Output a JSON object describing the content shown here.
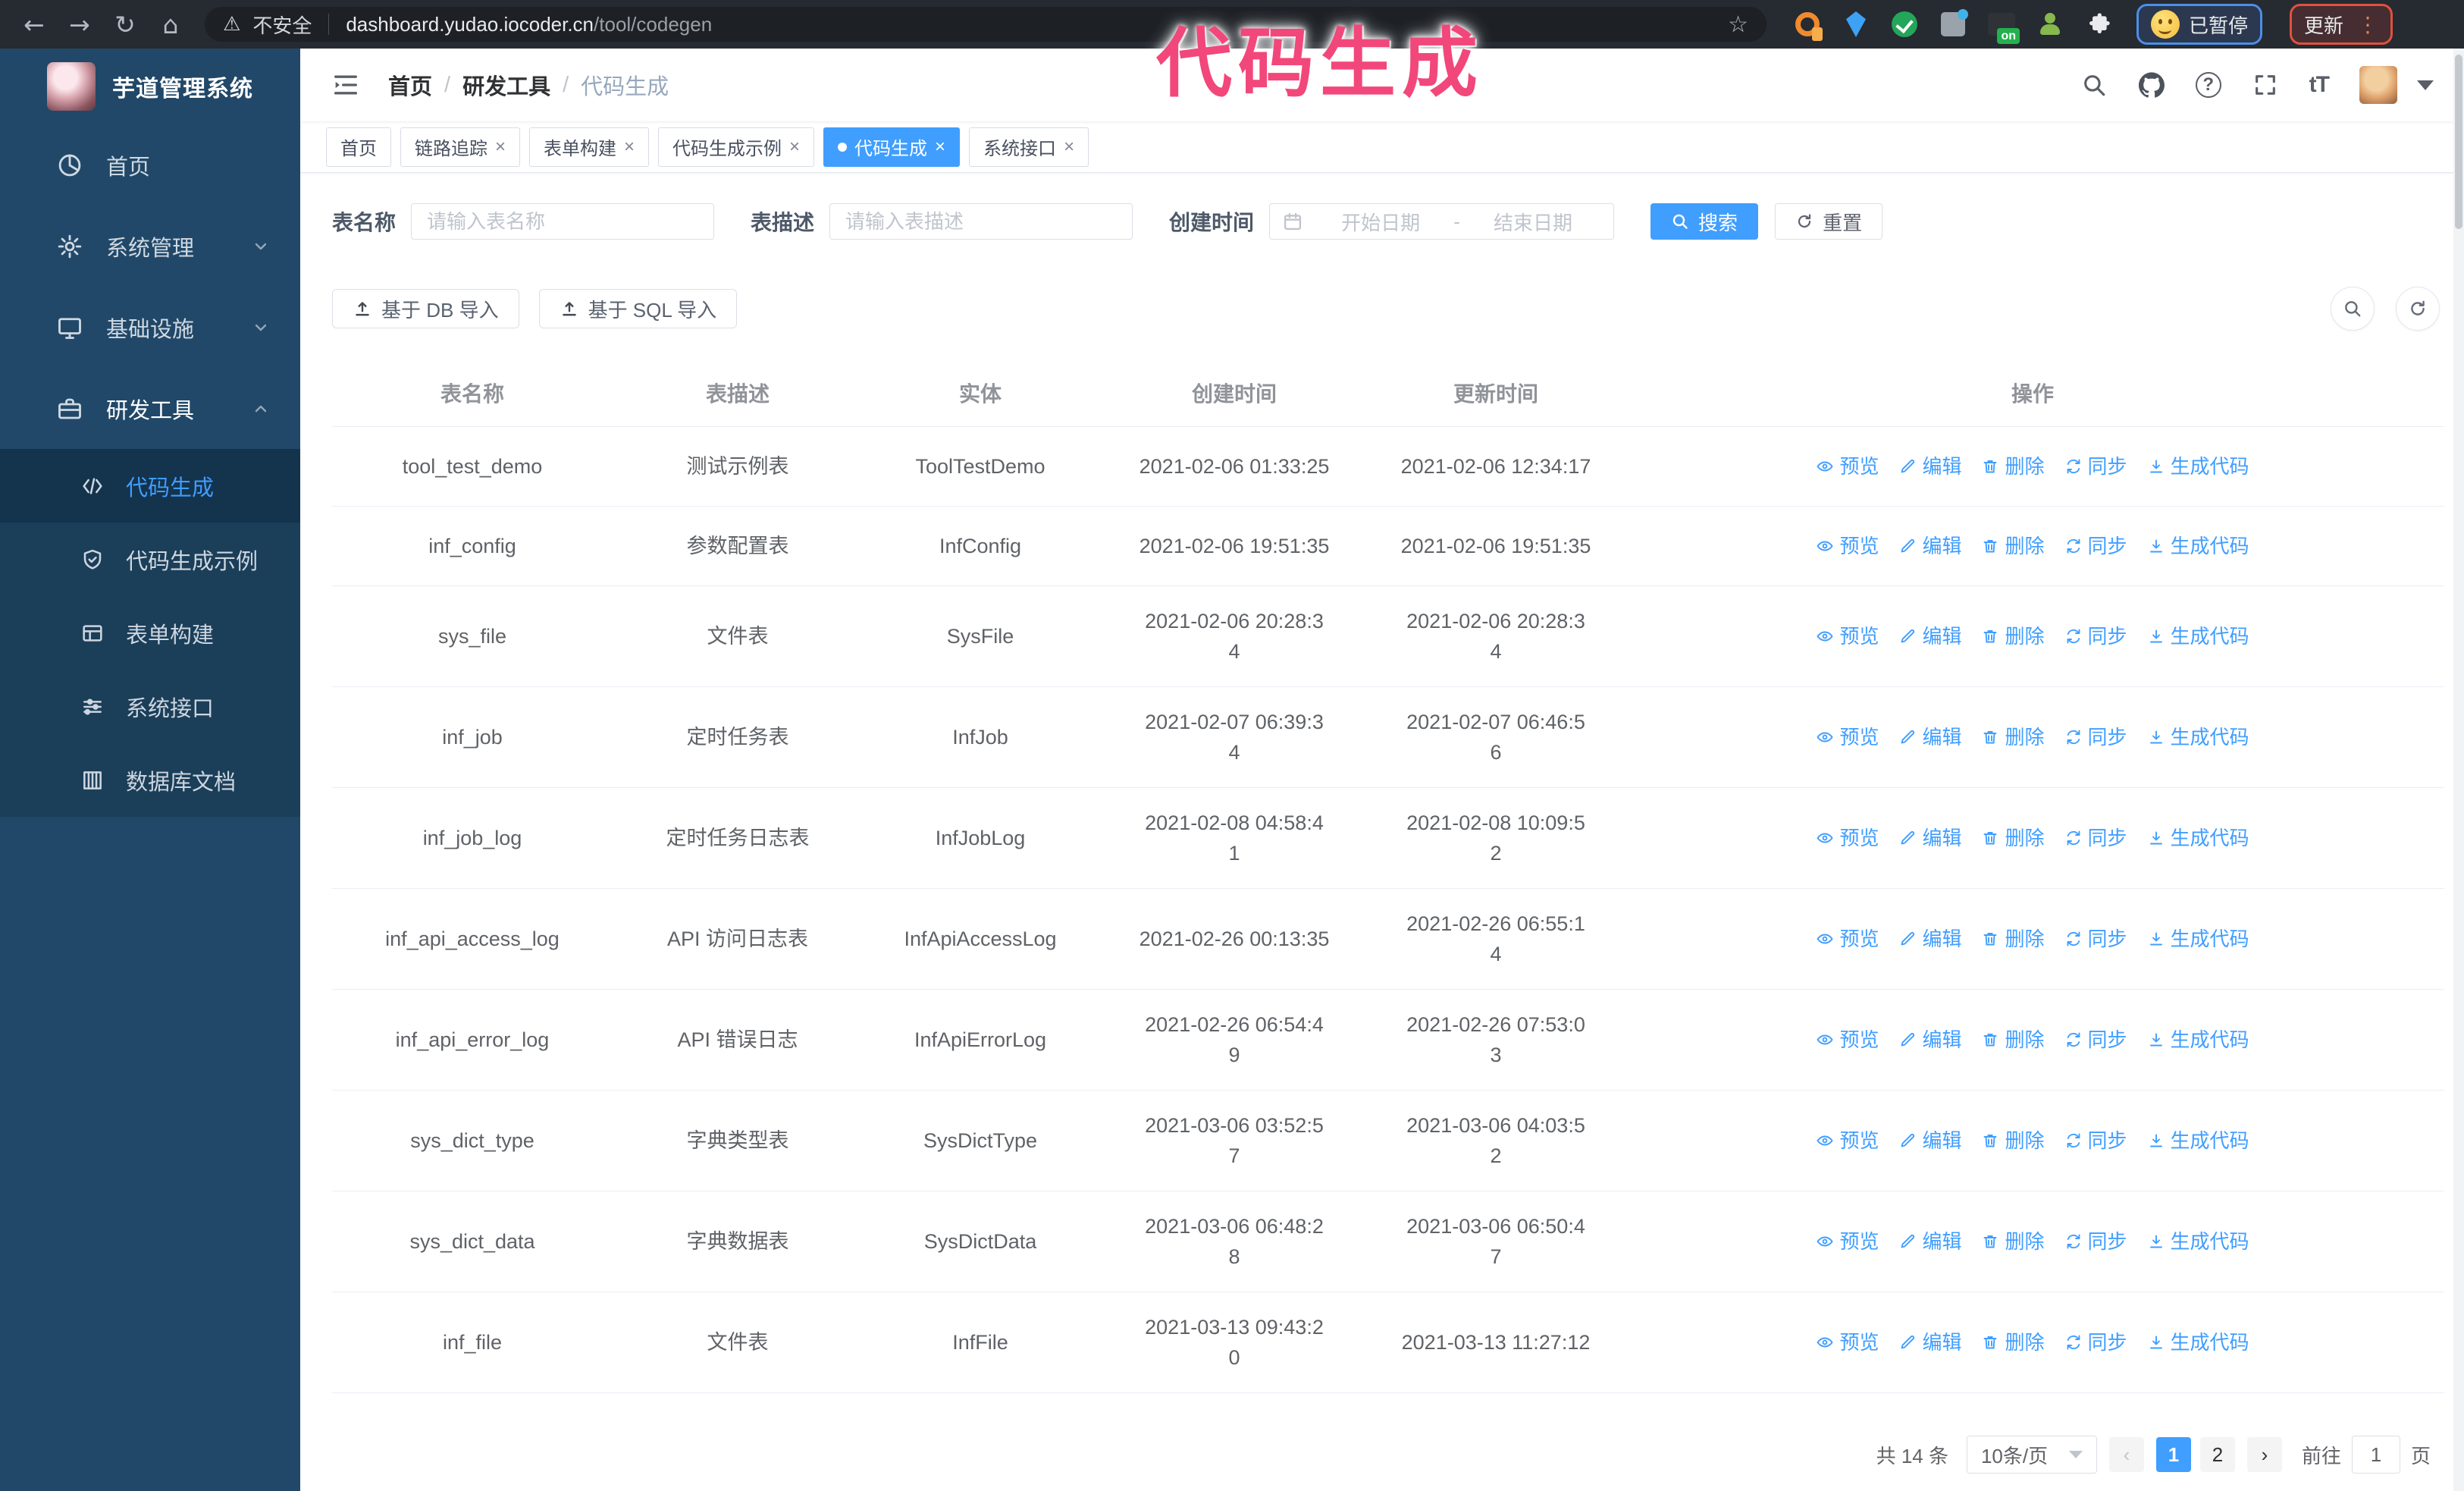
{
  "browser": {
    "security_label": "不安全",
    "url_host": "dashboard.yudao.iocoder.cn",
    "url_path": "/tool/codegen",
    "extension_badge": "on",
    "paused_badge": "已暂停",
    "update_button": "更新",
    "extension_icons": [
      "key-extension-icon",
      "gem-extension-icon",
      "check-extension-icon",
      "grid-extension-icon",
      "onbox-extension-icon",
      "person-extension-icon",
      "puzzle-extension-icon"
    ]
  },
  "glyphs": {
    "back": "←",
    "forward": "→",
    "reload": "↻",
    "home": "⌂",
    "warning": "⚠",
    "star": "☆",
    "dots": "⋮",
    "question": "?",
    "font_size": "tT",
    "slash": "/",
    "close": "×"
  },
  "annotation": {
    "text": "代码生成",
    "color": "#f2477a"
  },
  "sidebar": {
    "app_title": "芋道管理系统",
    "items": [
      {
        "key": "home",
        "label": "首页",
        "icon": "dashboard-icon",
        "expandable": false,
        "state": "none"
      },
      {
        "key": "system",
        "label": "系统管理",
        "icon": "gear-icon",
        "expandable": true,
        "state": "collapsed"
      },
      {
        "key": "infra",
        "label": "基础设施",
        "icon": "monitor-icon",
        "expandable": true,
        "state": "collapsed"
      },
      {
        "key": "devtools",
        "label": "研发工具",
        "icon": "toolbox-icon",
        "expandable": true,
        "state": "expanded"
      }
    ],
    "submenu": [
      {
        "key": "codegen",
        "label": "代码生成",
        "icon": "code-icon",
        "active": true
      },
      {
        "key": "codegen-demo",
        "label": "代码生成示例",
        "icon": "shield-check-icon",
        "active": false
      },
      {
        "key": "form-builder",
        "label": "表单构建",
        "icon": "form-icon",
        "active": false
      },
      {
        "key": "system-api",
        "label": "系统接口",
        "icon": "sliders-icon",
        "active": false
      },
      {
        "key": "db-doc",
        "label": "数据库文档",
        "icon": "database-icon",
        "active": false
      }
    ]
  },
  "header": {
    "breadcrumb": [
      "首页",
      "研发工具",
      "代码生成"
    ],
    "right_icons": [
      "search-icon",
      "github-icon",
      "question-icon",
      "fullscreen-icon",
      "font-size-icon",
      "avatar",
      "caret-down-icon"
    ]
  },
  "tabs": [
    {
      "label": "首页",
      "closable": false,
      "active": false
    },
    {
      "label": "链路追踪",
      "closable": true,
      "active": false
    },
    {
      "label": "表单构建",
      "closable": true,
      "active": false
    },
    {
      "label": "代码生成示例",
      "closable": true,
      "active": false
    },
    {
      "label": "代码生成",
      "closable": true,
      "active": true
    },
    {
      "label": "系统接口",
      "closable": true,
      "active": false
    }
  ],
  "search_form": {
    "table_name_label": "表名称",
    "table_name_placeholder": "请输入表名称",
    "table_desc_label": "表描述",
    "table_desc_placeholder": "请输入表描述",
    "create_time_label": "创建时间",
    "date_start_placeholder": "开始日期",
    "date_separator": "-",
    "date_end_placeholder": "结束日期",
    "search_button": "搜索",
    "reset_button": "重置"
  },
  "toolbar": {
    "import_db_button": "基于 DB 导入",
    "import_sql_button": "基于 SQL 导入",
    "right_tools": [
      "search-icon",
      "refresh-icon"
    ]
  },
  "table": {
    "columns": [
      "表名称",
      "表描述",
      "实体",
      "创建时间",
      "更新时间",
      "操作"
    ],
    "actions": [
      "预览",
      "编辑",
      "删除",
      "同步",
      "生成代码"
    ],
    "action_icons": [
      "eye-icon",
      "edit-icon",
      "delete-icon",
      "sync-icon",
      "download-icon"
    ],
    "rows": [
      {
        "name": "tool_test_demo",
        "desc": "测试示例表",
        "entity": "ToolTestDemo",
        "created": "2021-02-06 01:33:25",
        "updated": "2021-02-06 12:34:17"
      },
      {
        "name": "inf_config",
        "desc": "参数配置表",
        "entity": "InfConfig",
        "created": "2021-02-06 19:51:35",
        "updated": "2021-02-06 19:51:35"
      },
      {
        "name": "sys_file",
        "desc": "文件表",
        "entity": "SysFile",
        "created": "2021-02-06 20:28:34",
        "updated": "2021-02-06 20:28:34"
      },
      {
        "name": "inf_job",
        "desc": "定时任务表",
        "entity": "InfJob",
        "created": "2021-02-07 06:39:34",
        "updated": "2021-02-07 06:46:56"
      },
      {
        "name": "inf_job_log",
        "desc": "定时任务日志表",
        "entity": "InfJobLog",
        "created": "2021-02-08 04:58:41",
        "updated": "2021-02-08 10:09:52"
      },
      {
        "name": "inf_api_access_log",
        "desc": "API 访问日志表",
        "entity": "InfApiAccessLog",
        "created": "2021-02-26 00:13:35",
        "updated": "2021-02-26 06:55:14"
      },
      {
        "name": "inf_api_error_log",
        "desc": "API 错误日志",
        "entity": "InfApiErrorLog",
        "created": "2021-02-26 06:54:49",
        "updated": "2021-02-26 07:53:03"
      },
      {
        "name": "sys_dict_type",
        "desc": "字典类型表",
        "entity": "SysDictType",
        "created": "2021-03-06 03:52:57",
        "updated": "2021-03-06 04:03:52"
      },
      {
        "name": "sys_dict_data",
        "desc": "字典数据表",
        "entity": "SysDictData",
        "created": "2021-03-06 06:48:28",
        "updated": "2021-03-06 06:50:47"
      },
      {
        "name": "inf_file",
        "desc": "文件表",
        "entity": "InfFile",
        "created": "2021-03-13 09:43:20",
        "updated": "2021-03-13 11:27:12"
      }
    ]
  },
  "pagination": {
    "total_text": "共 14 条",
    "page_size": "10条/页",
    "prev_glyph": "‹",
    "next_glyph": "›",
    "pages": [
      "1",
      "2"
    ],
    "active_page": "1",
    "goto_label": "前往",
    "goto_value": "1",
    "goto_suffix": "页"
  },
  "colors": {
    "primary": "#409eff",
    "sidebar_bg": "#214868",
    "annotation": "#f2477a",
    "active_tab": "#409eff"
  }
}
